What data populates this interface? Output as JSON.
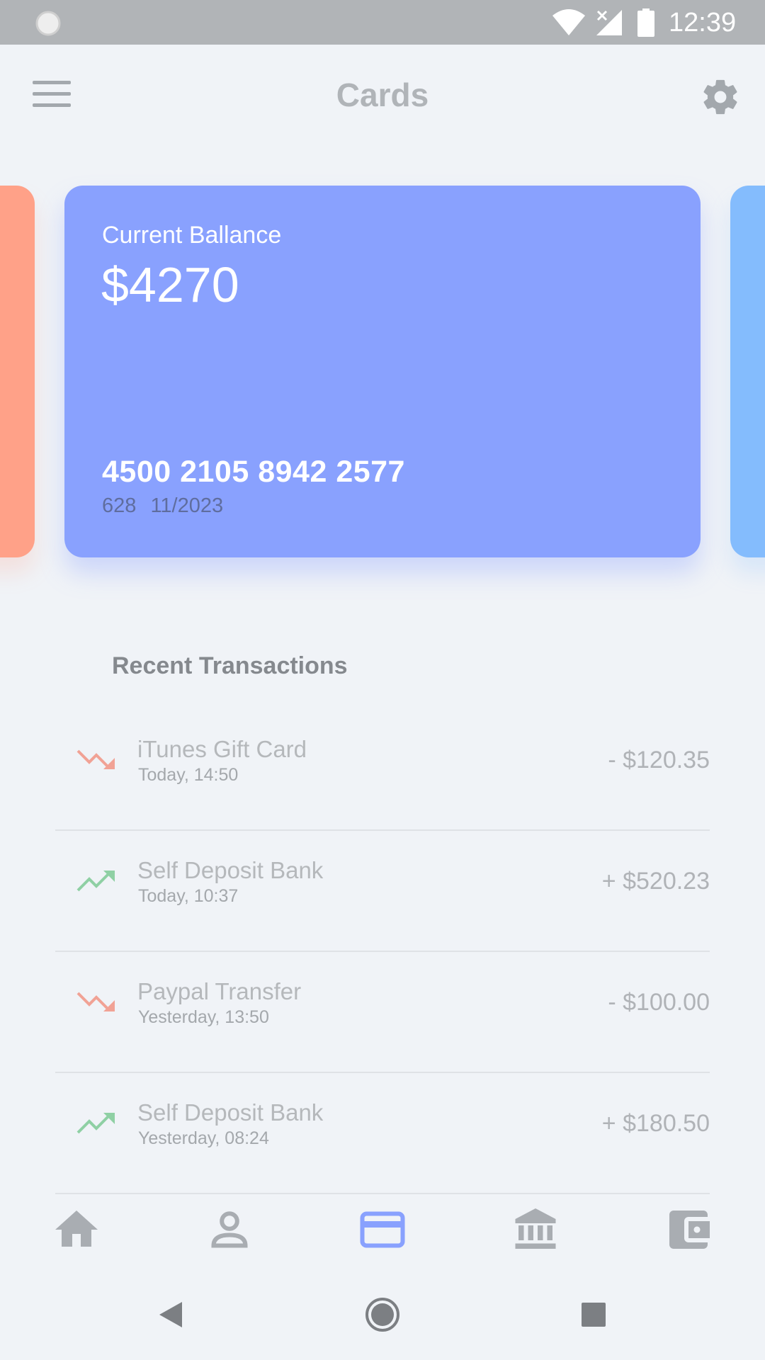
{
  "status_bar": {
    "time": "12:39",
    "icons": [
      "loading-icon",
      "wifi-icon",
      "signal-off-icon",
      "battery-icon"
    ]
  },
  "header": {
    "title": "Cards",
    "menu_icon": "hamburger-menu-icon",
    "settings_icon": "gear-icon"
  },
  "cards": {
    "current": {
      "balance_label": "Current Ballance",
      "balance": "$4270",
      "number": "4500 2105 8942 2577",
      "cvv": "628",
      "expiry": "11/2023",
      "color": "#89a1fe"
    },
    "peek_left_color": "#ffa188",
    "peek_right_color": "#84bcfd"
  },
  "transactions": {
    "title": "Recent Transactions",
    "items": [
      {
        "name": "iTunes Gift Card",
        "time": "Today, 14:50",
        "amount": "- $120.35",
        "trend": "down"
      },
      {
        "name": "Self Deposit Bank",
        "time": "Today, 10:37",
        "amount": "+ $520.23",
        "trend": "up"
      },
      {
        "name": "Paypal Transfer",
        "time": "Yesterday, 13:50",
        "amount": "- $100.00",
        "trend": "down"
      },
      {
        "name": "Self Deposit Bank",
        "time": "Yesterday, 08:24",
        "amount": "+ $180.50",
        "trend": "up"
      }
    ]
  },
  "bottom_nav": {
    "items": [
      "home-icon",
      "profile-icon",
      "card-icon",
      "bank-icon",
      "wallet-icon"
    ],
    "active": "card-icon",
    "active_color": "#89a1fe",
    "inactive_color": "#a9adb2"
  },
  "system_nav": [
    "back-icon",
    "home-circle-icon",
    "recents-icon"
  ],
  "colors": {
    "trend_down": "#f1a295",
    "trend_up": "#8fd0a4",
    "background": "#f0f3f7"
  }
}
